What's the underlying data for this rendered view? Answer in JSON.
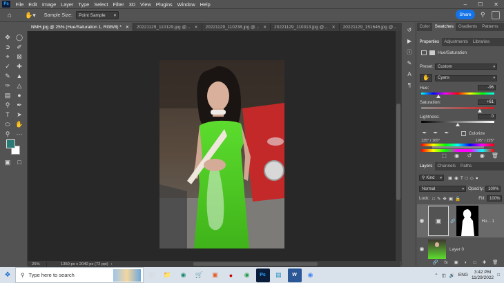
{
  "app": {
    "logo": "Ps",
    "menu": [
      "File",
      "Edit",
      "Image",
      "Layer",
      "Type",
      "Select",
      "Filter",
      "3D",
      "View",
      "Plugins",
      "Window",
      "Help"
    ],
    "window_buttons": [
      "minimize",
      "maximize",
      "close"
    ]
  },
  "options": {
    "sample_size_label": "Sample Size:",
    "sample_size_value": "Point Sample",
    "share_label": "Share"
  },
  "tabs": [
    {
      "label": "NMH.jpg @ 25% (Hue/Saturation 1, RGB/8) *",
      "active": true
    },
    {
      "label": "20221129_110129.jpg @...",
      "active": false
    },
    {
      "label": "20221129_110238.jpg @...",
      "active": false
    },
    {
      "label": "20221129_110313.jpg @...",
      "active": false
    },
    {
      "label": "20221129_151646.jpg @...",
      "active": false
    }
  ],
  "status": {
    "zoom": "25%",
    "info": "1350 px x 2040 px (72 ppi)"
  },
  "panel_tabs_top": [
    "Color",
    "Swatches",
    "Gradients",
    "Patterns"
  ],
  "panel_tabs_mid": [
    "Properties",
    "Adjustments",
    "Libraries"
  ],
  "properties": {
    "title": "Hue/Saturation",
    "preset_label": "Preset:",
    "preset_value": "Custom",
    "channel_value": "Cyans",
    "hue_label": "Hue:",
    "hue_value": "-96",
    "saturation_label": "Saturation:",
    "saturation_value": "+61",
    "lightness_label": "Lightness:",
    "lightness_value": "0",
    "colorize_label": "Colorize",
    "range_left": "135° / 165°",
    "range_right": "195° / 225°",
    "hue_level": -96,
    "saturation_level": 61,
    "lightness_level": 0
  },
  "layers": {
    "tabs": [
      "Layers",
      "Channels",
      "Paths"
    ],
    "kind_label": "Kind",
    "blend_mode": "Normal",
    "opacity_label": "Opacity:",
    "opacity_value": "100%",
    "lock_label": "Lock:",
    "fill_label": "Fill:",
    "fill_value": "100%",
    "items": [
      {
        "name": "Hu... 1"
      },
      {
        "name": "Layer 0"
      }
    ]
  },
  "taskbar": {
    "search_placeholder": "Type here to search",
    "lang": "ENG",
    "time": "3:42 PM",
    "date": "11/29/2022"
  },
  "colors": {
    "accent": "#1473e6",
    "foreground": "#2a7b76",
    "background": "#ffffff"
  }
}
